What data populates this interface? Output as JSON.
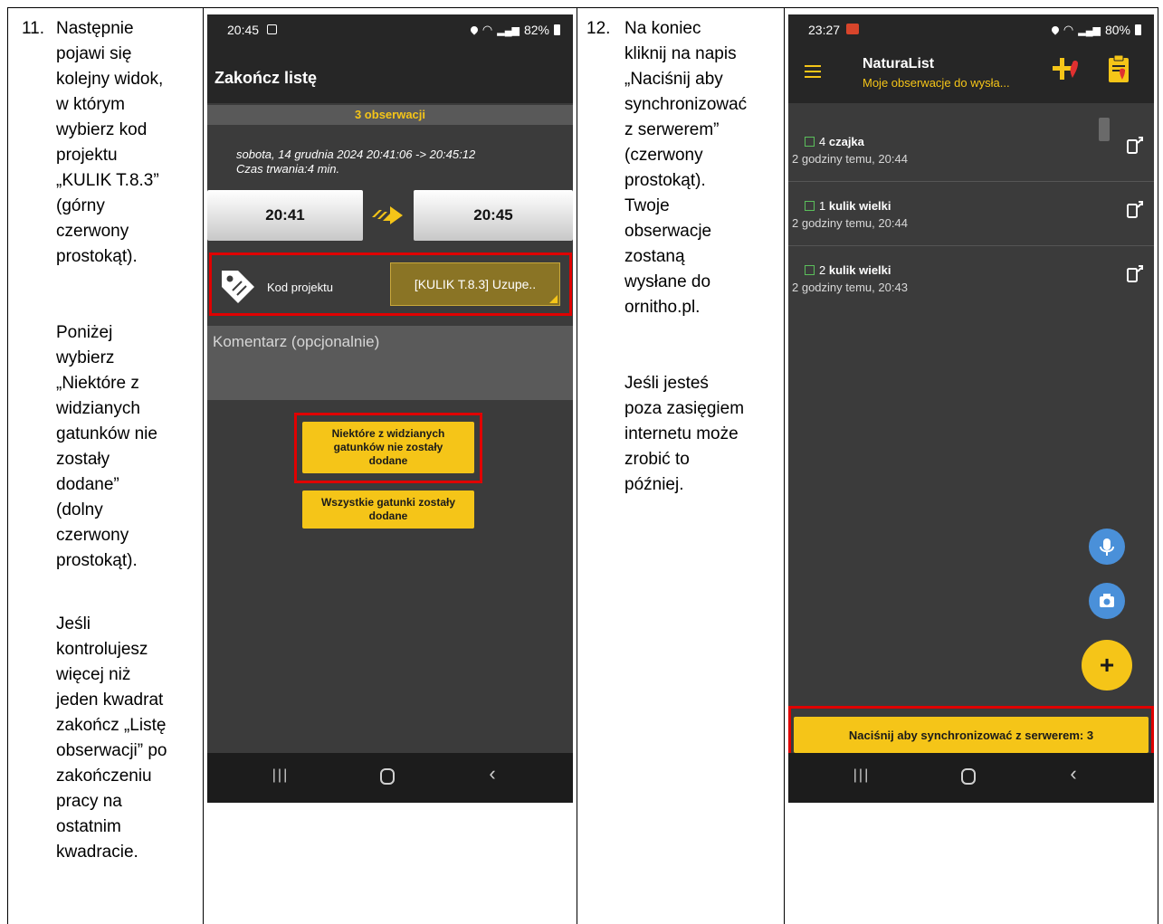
{
  "step11": {
    "number": "11.",
    "paragraphs": [
      "Następnie\npojawi się\nkolejny widok,\nw którym\nwybierz kod\nprojektu\n„KULIK T.8.3”\n(górny\nczerwony\nprostokąt).",
      "Poniżej\nwybierz\n„Niektóre z\nwidzianych\ngatunków nie\nzostały\ndodane”\n(dolny\nczerwony\nprostokąt).",
      "Jeśli\nkontrolujesz\nwięcej niż\njeden kwadrat\nzakończ „Listę\nobserwacji” po\nzakończeniu\npracy na\nostatnim\nkwadracie."
    ]
  },
  "step12": {
    "number": "12.",
    "paragraphs": [
      "Na koniec\nkliknij na napis\n„Naciśnij aby\nsynchronizować\nz serwerem”\n(czerwony\nprostokąt).\nTwoje\nobserwacje\nzostaną\nwysłane do\nornitho.pl.",
      "Jeśli jesteś\npoza zasięgiem\ninternetu może\nzrobić to\npóźniej."
    ]
  },
  "screen1": {
    "status_time": "20:45",
    "battery": "82%",
    "title": "Zakończ listę",
    "obs_count": "3 obserwacji",
    "date_line": "sobota, 14 grudnia 2024 20:41:06 -> 20:45:12",
    "duration": "Czas trwania:4 min.",
    "start_time": "20:41",
    "end_time": "20:45",
    "project_label": "Kod projektu",
    "project_value": "[KULIK T.8.3] Uzupe..",
    "comment_placeholder": "Komentarz (opcjonalnie)",
    "btn_some": "Niektóre z widzianych\ngatunków nie zostały\ndodane",
    "btn_all": "Wszystkie gatunki zostały\ndodane"
  },
  "screen2": {
    "status_time": "23:27",
    "battery": "80%",
    "app_title": "NaturaList",
    "app_subtitle": "Moje obserwacje do wysła...",
    "items": [
      {
        "count": "4",
        "species": "czajka",
        "time": "2 godziny temu, 20:44"
      },
      {
        "count": "1",
        "species": "kulik wielki",
        "time": "2 godziny temu, 20:44"
      },
      {
        "count": "2",
        "species": "kulik wielki",
        "time": "2 godziny temu, 20:43"
      }
    ],
    "sync_button": "Naciśnij aby synchronizować z serwerem: 3"
  },
  "colors": {
    "accent_yellow": "#f5c518",
    "highlight_red": "#e00000",
    "fab_blue": "#4a90d9"
  }
}
